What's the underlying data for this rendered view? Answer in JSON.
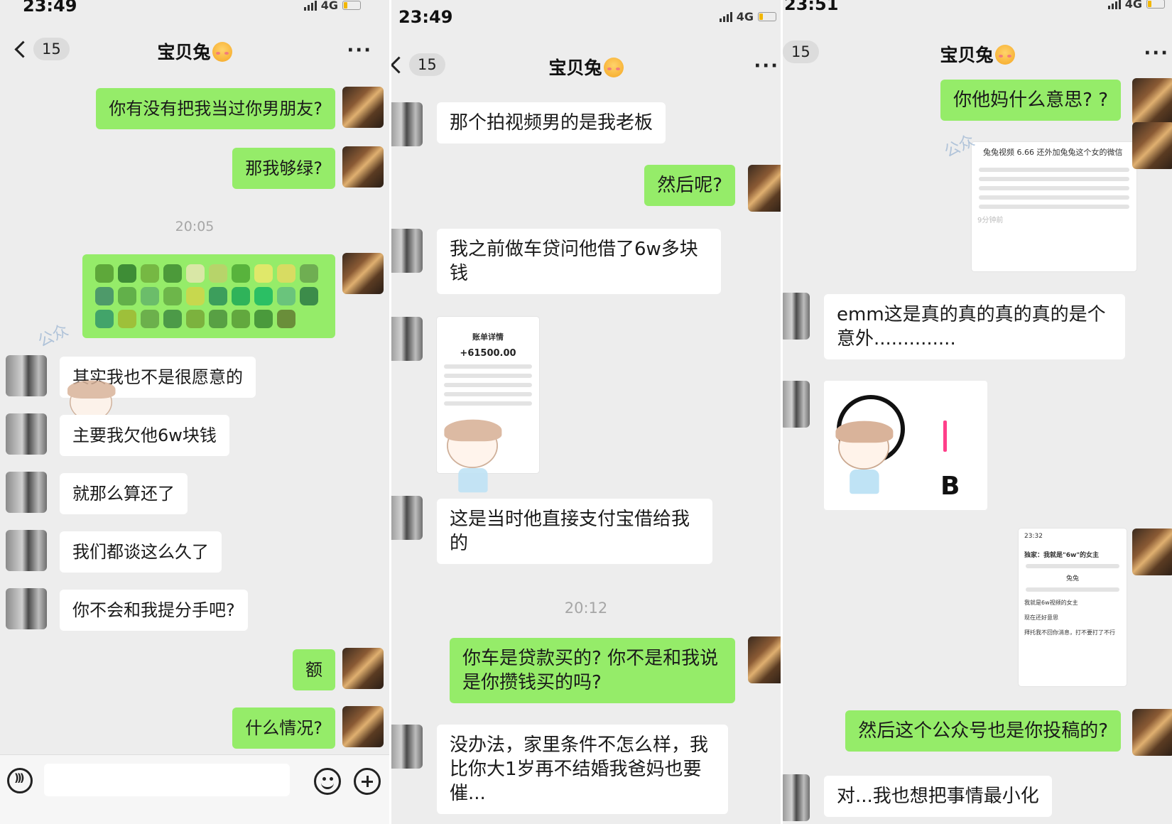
{
  "panels": [
    {
      "status_time": "23:49",
      "network": "4G",
      "unread_count": "15",
      "contact_name": "宝贝兔",
      "timestamp": "20:05",
      "watermark": "公众",
      "messages": [
        {
          "from": "me",
          "text": "你有没有把我当过你男朋友?"
        },
        {
          "from": "me",
          "text": "那我够绿?"
        },
        {
          "from": "me",
          "type": "emoji-row",
          "emoji_colors": [
            "#5ea83a",
            "#3e8d36",
            "#76b843",
            "#4c9a3a",
            "#d9e7a6",
            "#b7d46a",
            "#58b33c",
            "#e0e86a",
            "#d8dc62",
            "#6fae52",
            "#4e9a6a",
            "#62b04a",
            "#6bbd6a",
            "#6db64a",
            "#c7d84e",
            "#3c9e5c",
            "#2fb35a",
            "#2bbf64",
            "#6ac47c",
            "#3c8c4a",
            "#42a46a",
            "#9ec03a",
            "#6cb04c",
            "#4c9a48",
            "#7cb23e",
            "#58a044",
            "#62a83e",
            "#4a9a3c",
            "#6a8e3a"
          ]
        },
        {
          "from": "her",
          "text": "其实我也不是很愿意的"
        },
        {
          "from": "her",
          "text": "主要我欠他6w块钱"
        },
        {
          "from": "her",
          "text": "就那么算还了"
        },
        {
          "from": "her",
          "text": "我们都谈这么久了"
        },
        {
          "from": "her",
          "text": "你不会和我提分手吧?"
        },
        {
          "from": "me",
          "text": "额"
        },
        {
          "from": "me",
          "text": "什么情况?"
        }
      ]
    },
    {
      "status_time": "23:49",
      "network": "4G",
      "unread_count": "15",
      "contact_name": "宝贝兔",
      "timestamp": "20:12",
      "messages": [
        {
          "from": "her",
          "text": "那个拍视频男的是我老板"
        },
        {
          "from": "me",
          "text": "然后呢?"
        },
        {
          "from": "her",
          "text": "我之前做车贷问他借了6w多块钱"
        },
        {
          "from": "her",
          "type": "image",
          "screenshot_title": "账单详情",
          "amount": "+61500.00"
        },
        {
          "from": "her",
          "text": "这是当时他直接支付宝借给我的"
        },
        {
          "from": "me",
          "text": "你车是贷款买的? 你不是和我说是你攒钱买的吗?"
        },
        {
          "from": "her",
          "text": "没办法，家里条件不怎么样，我比你大1岁再不结婚我爸妈也要催..."
        }
      ]
    },
    {
      "status_time": "23:51",
      "network": "4G",
      "unread_count": "15",
      "contact_name": "宝贝兔",
      "watermark": "公众",
      "messages": [
        {
          "from": "me",
          "text": "你他妈什么意思? ?"
        },
        {
          "from": "me",
          "type": "image",
          "caption": "兔兔视频 6.66 还外加兔兔这个女的微信",
          "footer": "9分钟前"
        },
        {
          "from": "her",
          "text": "emm这是真的真的真的真的是个意外.............."
        },
        {
          "from": "her",
          "type": "sticker",
          "sticker_text": "B"
        },
        {
          "from": "me",
          "type": "image",
          "screenshot_time": "23:32",
          "headline": "独家：我就是\"6w\"的女主",
          "chat_name": "兔兔",
          "rows": [
            "我就是6w视频的女主",
            "现在还好意思",
            "拜托我不回你消息，打不要打了不行"
          ]
        },
        {
          "from": "me",
          "text": "然后这个公众号也是你投稿的?"
        },
        {
          "from": "her",
          "text": "对...我也想把事情最小化"
        }
      ]
    }
  ],
  "colors": {
    "chat_bg": "#ededed",
    "my_bubble": "#95ec69",
    "her_bubble": "#ffffff",
    "timestamp_text": "#a6a6a6"
  },
  "icons": [
    "back-chevron-icon",
    "more-icon",
    "voice-icon",
    "emoji-icon",
    "plus-icon"
  ]
}
